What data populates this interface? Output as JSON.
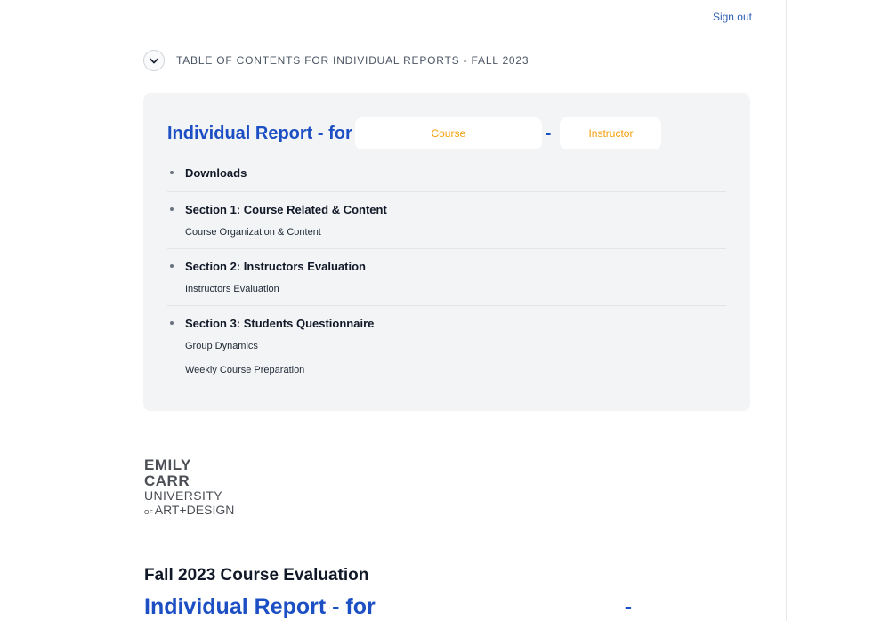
{
  "header": {
    "signout_label": "Sign out"
  },
  "toc": {
    "title": "TABLE OF CONTENTS FOR INDIVIDUAL REPORTS - FALL 2023",
    "report_title": "Individual Report - for",
    "course_placeholder": "Course",
    "separator": "-",
    "instructor_placeholder": "Instructor",
    "items": [
      {
        "label": "Downloads",
        "subs": []
      },
      {
        "label": "Section 1: Course Related & Content",
        "subs": [
          "Course Organization & Content"
        ]
      },
      {
        "label": "Section 2: Instructors Evaluation",
        "subs": [
          "Instructors Evaluation"
        ]
      },
      {
        "label": "Section 3: Students Questionnaire",
        "subs": [
          "Group Dynamics",
          "Weekly Course Preparation"
        ]
      }
    ]
  },
  "logo": {
    "line1": "EMILY",
    "line2": "CARR",
    "line3": "UNIVERSITY",
    "of": "OF",
    "line4": "ART+DESIGN"
  },
  "evaluation": {
    "title": "Fall 2023 Course Evaluation",
    "report_title": "Individual Report - for",
    "separator": "-"
  },
  "colors": {
    "accent": "#1d4fc4",
    "link": "#2f5fb3",
    "placeholder": "#f59e0b",
    "panel": "#f3f4f6"
  }
}
